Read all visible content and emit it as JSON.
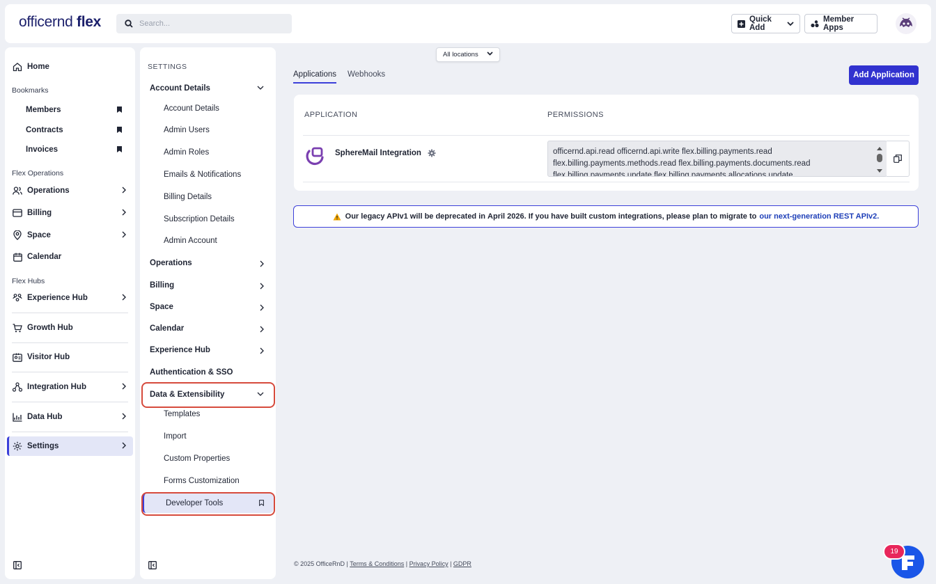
{
  "app": {
    "logo_regular": "officernd",
    "logo_bold": " flex"
  },
  "header": {
    "search_placeholder": "Search...",
    "quick_add_label": "Quick Add",
    "member_apps_label": "Member Apps"
  },
  "nav": {
    "home": "Home",
    "bookmarks_group": "Bookmarks",
    "bookmarks": [
      "Members",
      "Contracts",
      "Invoices"
    ],
    "flex_operations_group": "Flex Operations",
    "operations": "Operations",
    "billing": "Billing",
    "space": "Space",
    "calendar": "Calendar",
    "flex_hubs_group": "Flex Hubs",
    "experience_hub": "Experience Hub",
    "growth_hub": "Growth Hub",
    "visitor_hub": "Visitor Hub",
    "integration_hub": "Integration Hub",
    "data_hub": "Data Hub",
    "settings": "Settings"
  },
  "settings_panel": {
    "header": "SETTINGS",
    "account_details_section": "Account Details",
    "account_sub": [
      "Account Details",
      "Admin Users",
      "Admin Roles",
      "Emails & Notifications",
      "Billing Details",
      "Subscription Details",
      "Admin Account"
    ],
    "operations": "Operations",
    "billing": "Billing",
    "space": "Space",
    "calendar": "Calendar",
    "experience_hub": "Experience Hub",
    "auth_sso": "Authentication & SSO",
    "data_ext_section": "Data & Extensibility",
    "data_sub": [
      "Templates",
      "Import",
      "Custom Properties",
      "Forms Customization"
    ],
    "developer_tools": "Developer Tools"
  },
  "main": {
    "location_filter": "All locations",
    "tabs": [
      "Applications",
      "Webhooks"
    ],
    "add_application_label": "Add Application",
    "col_application": "APPLICATION",
    "col_permissions": "PERMISSIONS",
    "app_row": {
      "name": "SphereMail Integration",
      "permissions": "officernd.api.read officernd.api.write flex.billing.payments.read flex.billing.payments.methods.read flex.billing.payments.documents.read flex.billing.payments.update flex.billing.payments.allocations.update"
    },
    "banner": {
      "part1": "Our legacy APIv1 will be deprecated in ",
      "bold_date": "April 2026.",
      "part2": " If you have built custom integrations, please plan to migrate to",
      "link": "our next-generation REST APIv2."
    },
    "footer": {
      "copyright": "© 2025 OfficeRnD | ",
      "terms": "Terms & Conditions",
      "privacy": "Privacy Policy",
      "gdpr": "GDPR",
      "sep": " | "
    }
  },
  "chat": {
    "badge_count": "19"
  },
  "colors": {
    "accent": "#3132cf",
    "highlight": "#d64a3c",
    "badge": "#e8265b"
  }
}
